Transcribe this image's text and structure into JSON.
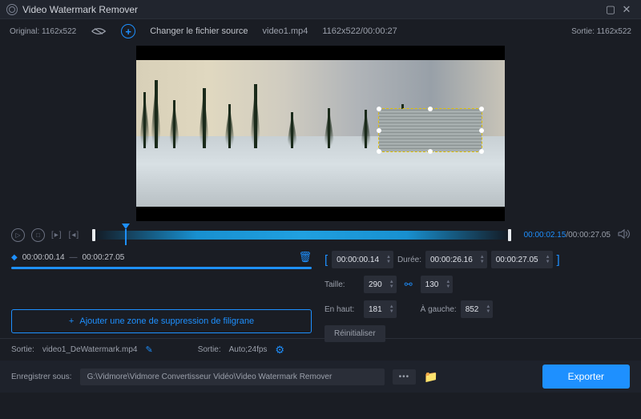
{
  "window": {
    "title": "Video Watermark Remover"
  },
  "header": {
    "original": "Original: 1162x522",
    "change_source": "Changer le fichier source",
    "filename": "video1.mp4",
    "dims_time": "1162x522/00:00:27",
    "output": "Sortie: 1162x522"
  },
  "timeline": {
    "current": "00:00:02.15",
    "total": "/00:00:27.05"
  },
  "range": {
    "start": "00:00:00.14",
    "end": "00:00:27.05"
  },
  "add_zone": "Ajouter une zone de suppression de filigrane",
  "times": {
    "start": "00:00:00.14",
    "dur_label": "Durée:",
    "dur": "00:00:26.16",
    "end": "00:00:27.05"
  },
  "size": {
    "label": "Taille:",
    "w": "290",
    "h": "130"
  },
  "pos": {
    "top_label": "En haut:",
    "top": "181",
    "left_label": "À gauche:",
    "left": "852"
  },
  "reset": "Réinitialiser",
  "footer1": {
    "out_label": "Sortie:",
    "out_file": "video1_DeWatermark.mp4",
    "fmt_label": "Sortie:",
    "fmt": "Auto;24fps"
  },
  "footer2": {
    "save_label": "Enregistrer sous:",
    "path": "G:\\Vidmore\\Vidmore Convertisseur Vidéo\\Video Watermark Remover",
    "export": "Exporter"
  }
}
